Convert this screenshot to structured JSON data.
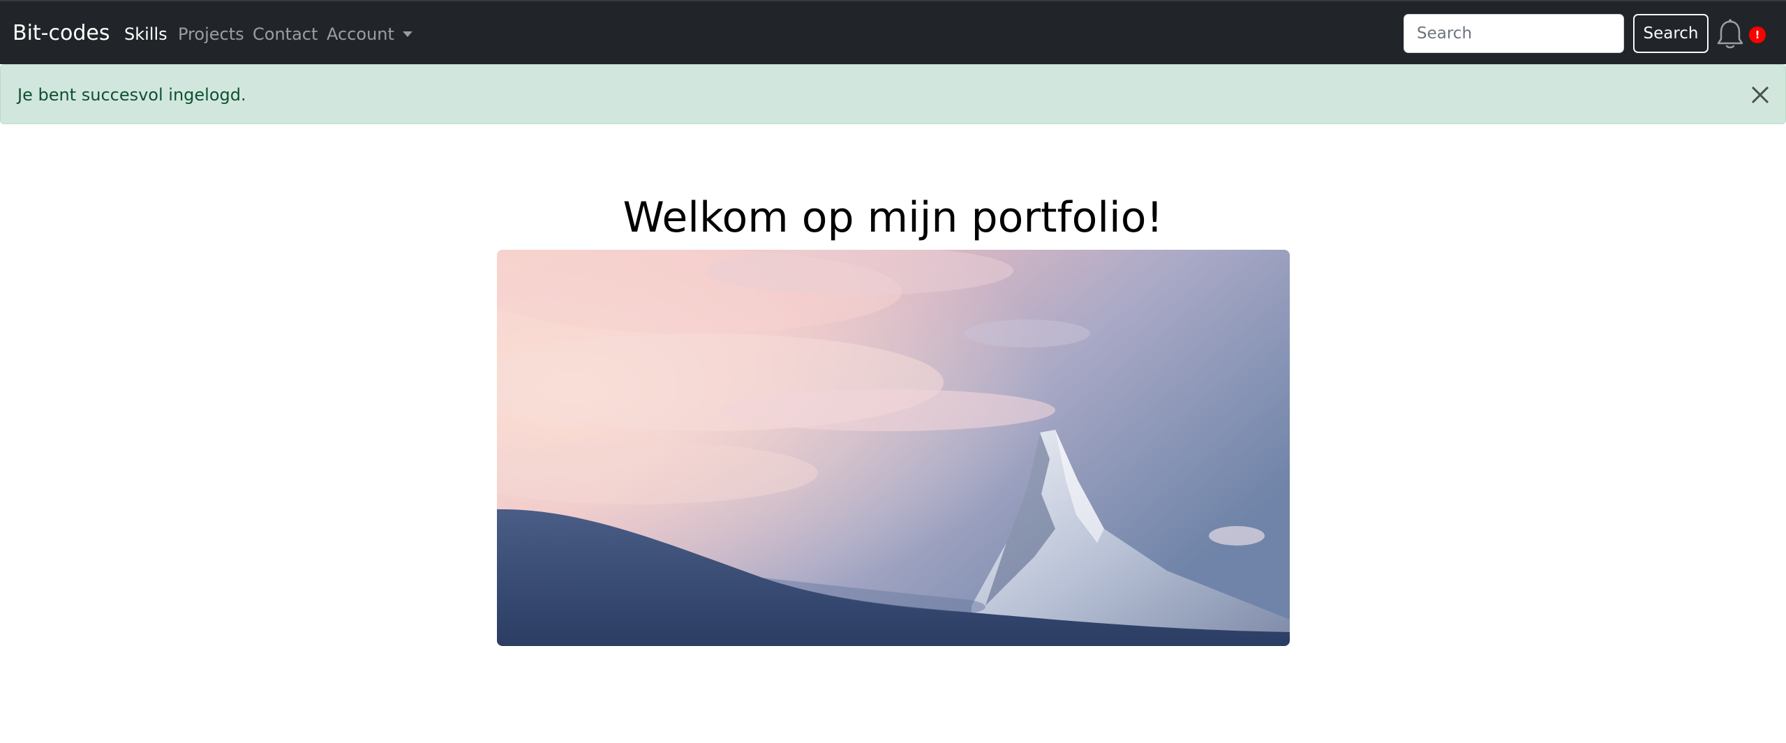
{
  "navbar": {
    "brand": "Bit-codes",
    "links": [
      {
        "label": "Skills",
        "active": true
      },
      {
        "label": "Projects",
        "active": false
      },
      {
        "label": "Contact",
        "active": false
      },
      {
        "label": "Account",
        "active": false,
        "dropdown": true
      }
    ],
    "search": {
      "placeholder": "Search",
      "value": "",
      "button_label": "Search"
    },
    "notification": {
      "icon": "bell-icon",
      "badge": "!",
      "badge_color": "#ff0000"
    }
  },
  "alert": {
    "message": "Je bent succesvol ingelogd.",
    "close_icon": "close-icon",
    "background": "#d1e7dd"
  },
  "main": {
    "title": "Welkom op mijn portfolio!",
    "hero_image": "mountain-landscape"
  },
  "colors": {
    "navbar_bg": "#212529",
    "alert_bg": "#d1e7dd",
    "alert_text": "#0f5132"
  }
}
